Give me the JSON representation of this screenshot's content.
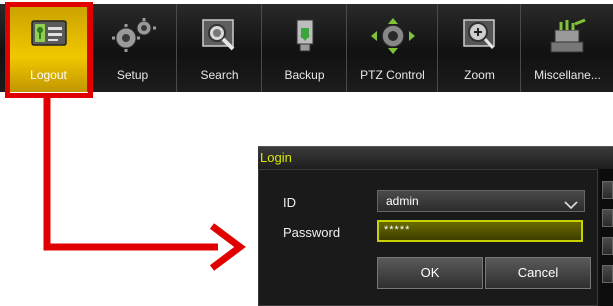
{
  "toolbar": {
    "items": [
      {
        "label": "Logout",
        "icon": "logout-icon"
      },
      {
        "label": "Setup",
        "icon": "gears-icon"
      },
      {
        "label": "Search",
        "icon": "search-icon"
      },
      {
        "label": "Backup",
        "icon": "usb-drive-icon"
      },
      {
        "label": "PTZ Control",
        "icon": "ptz-camera-icon"
      },
      {
        "label": "Zoom",
        "icon": "zoom-icon"
      },
      {
        "label": "Miscellane...",
        "icon": "plug-icon"
      }
    ]
  },
  "login_dialog": {
    "title": "Login",
    "id_label": "ID",
    "id_value": "admin",
    "password_label": "Password",
    "password_value": "*****",
    "ok_label": "OK",
    "cancel_label": "Cancel"
  },
  "colors": {
    "highlight": "#e00000",
    "active_tab": "#f0c800",
    "title_text": "#d8e800"
  }
}
